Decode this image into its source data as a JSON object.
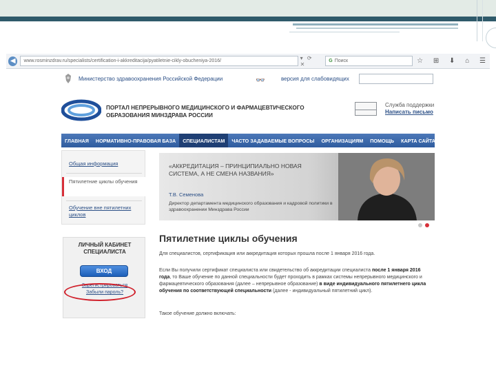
{
  "browser": {
    "url": "www.rosminzdrav.ru/specialists/certification-i-akkreditacija/pyatiletnie-cikly-obucheniya-2016/",
    "search_engine": "G",
    "search_placeholder": "Поиск"
  },
  "ministry": {
    "name": "Министерство здравоохранения Российской Федерации",
    "vision_version": "версия для слабовидящих"
  },
  "portal": {
    "title": "ПОРТАЛ НЕПРЕРЫВНОГО МЕДИЦИНСКОГО И ФАРМАЦЕВТИЧЕСКОГО ОБРАЗОВАНИЯ МИНЗДРАВА РОССИИ",
    "support_label": "Служба поддержки",
    "write_letter": "Написать письмо"
  },
  "nav": {
    "items": [
      "ГЛАВНАЯ",
      "НОРМАТИВНО-ПРАВОВАЯ БАЗА",
      "СПЕЦИАЛИСТАМ",
      "ЧАСТО ЗАДАВАЕМЫЕ ВОПРОСЫ",
      "ОРГАНИЗАЦИЯМ",
      "ПОМОЩЬ",
      "КАРТА САЙТА"
    ],
    "active": "СПЕЦИАЛИСТАМ"
  },
  "sidebar": {
    "items": [
      "Общая информация",
      "Пятилетние циклы обучения",
      "Обучение вне пятилетних циклов"
    ]
  },
  "banner": {
    "quote": "«АККРЕДИТАЦИЯ – ПРИНЦИПИАЛЬНО НОВАЯ СИСТЕМА, А НЕ СМЕНА НАЗВАНИЯ»",
    "name": "Т.В. Семенова",
    "role": "Директор департамента медицинского образования и кадровой политики в здравоохранении Минздрава России"
  },
  "cabinet": {
    "title": "ЛИЧНЫЙ КАБИНЕТ СПЕЦИАЛИСТА",
    "login": "ВХОД",
    "register": "Зарегистрироваться",
    "forgot": "Забыли пароль?"
  },
  "content": {
    "title": "Пятилетние циклы обучения",
    "intro": "Для специалистов, сертификация или аккредитация которых прошла после 1 января 2016 года.",
    "body_a": "Если Вы получили сертификат специалиста или свидетельство об аккредитации специалиста ",
    "body_b": "после 1 января 2016 года",
    "body_c": ", то Ваше обучение по данной специальности будет проходить в рамках системы непрерывного медицинского и фармацевтического образования (далее – непрерывное образование) ",
    "body_d": "в виде индивидуального пятилетнего цикла обучения по соответствующей специальности",
    "body_e": " (далее - индивидуальный пятилетний цикл).",
    "ending": "Такое обучение должно включать:"
  },
  "colors": {
    "nav_blue": "#2f5c9f",
    "link_blue": "#2b4f86",
    "accent_red": "#d01f2a"
  }
}
